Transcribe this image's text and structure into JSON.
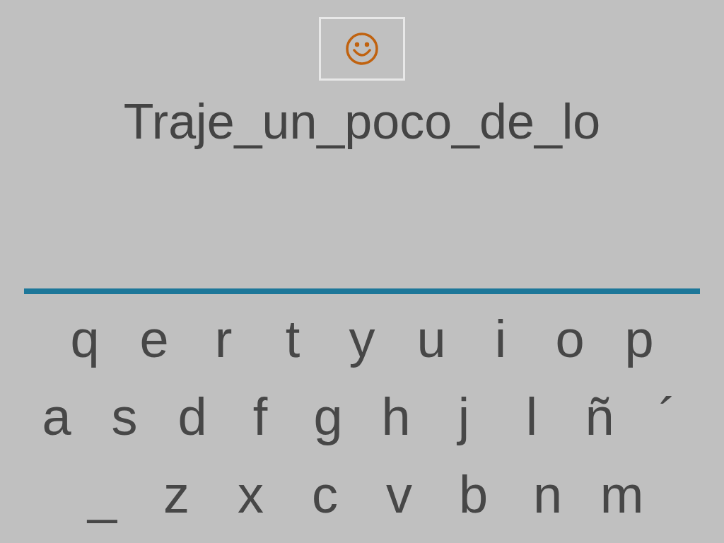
{
  "phrase": "Traje_un_poco_de_lo",
  "keyboard": {
    "rows": [
      [
        "q",
        "e",
        "r",
        "t",
        "y",
        "u",
        "i",
        "o",
        "p"
      ],
      [
        "a",
        "s",
        "d",
        "f",
        "g",
        "h",
        "j",
        "l",
        "ñ",
        "´"
      ],
      [
        "_",
        "z",
        "x",
        "c",
        "v",
        "b",
        "n",
        "m"
      ]
    ]
  }
}
